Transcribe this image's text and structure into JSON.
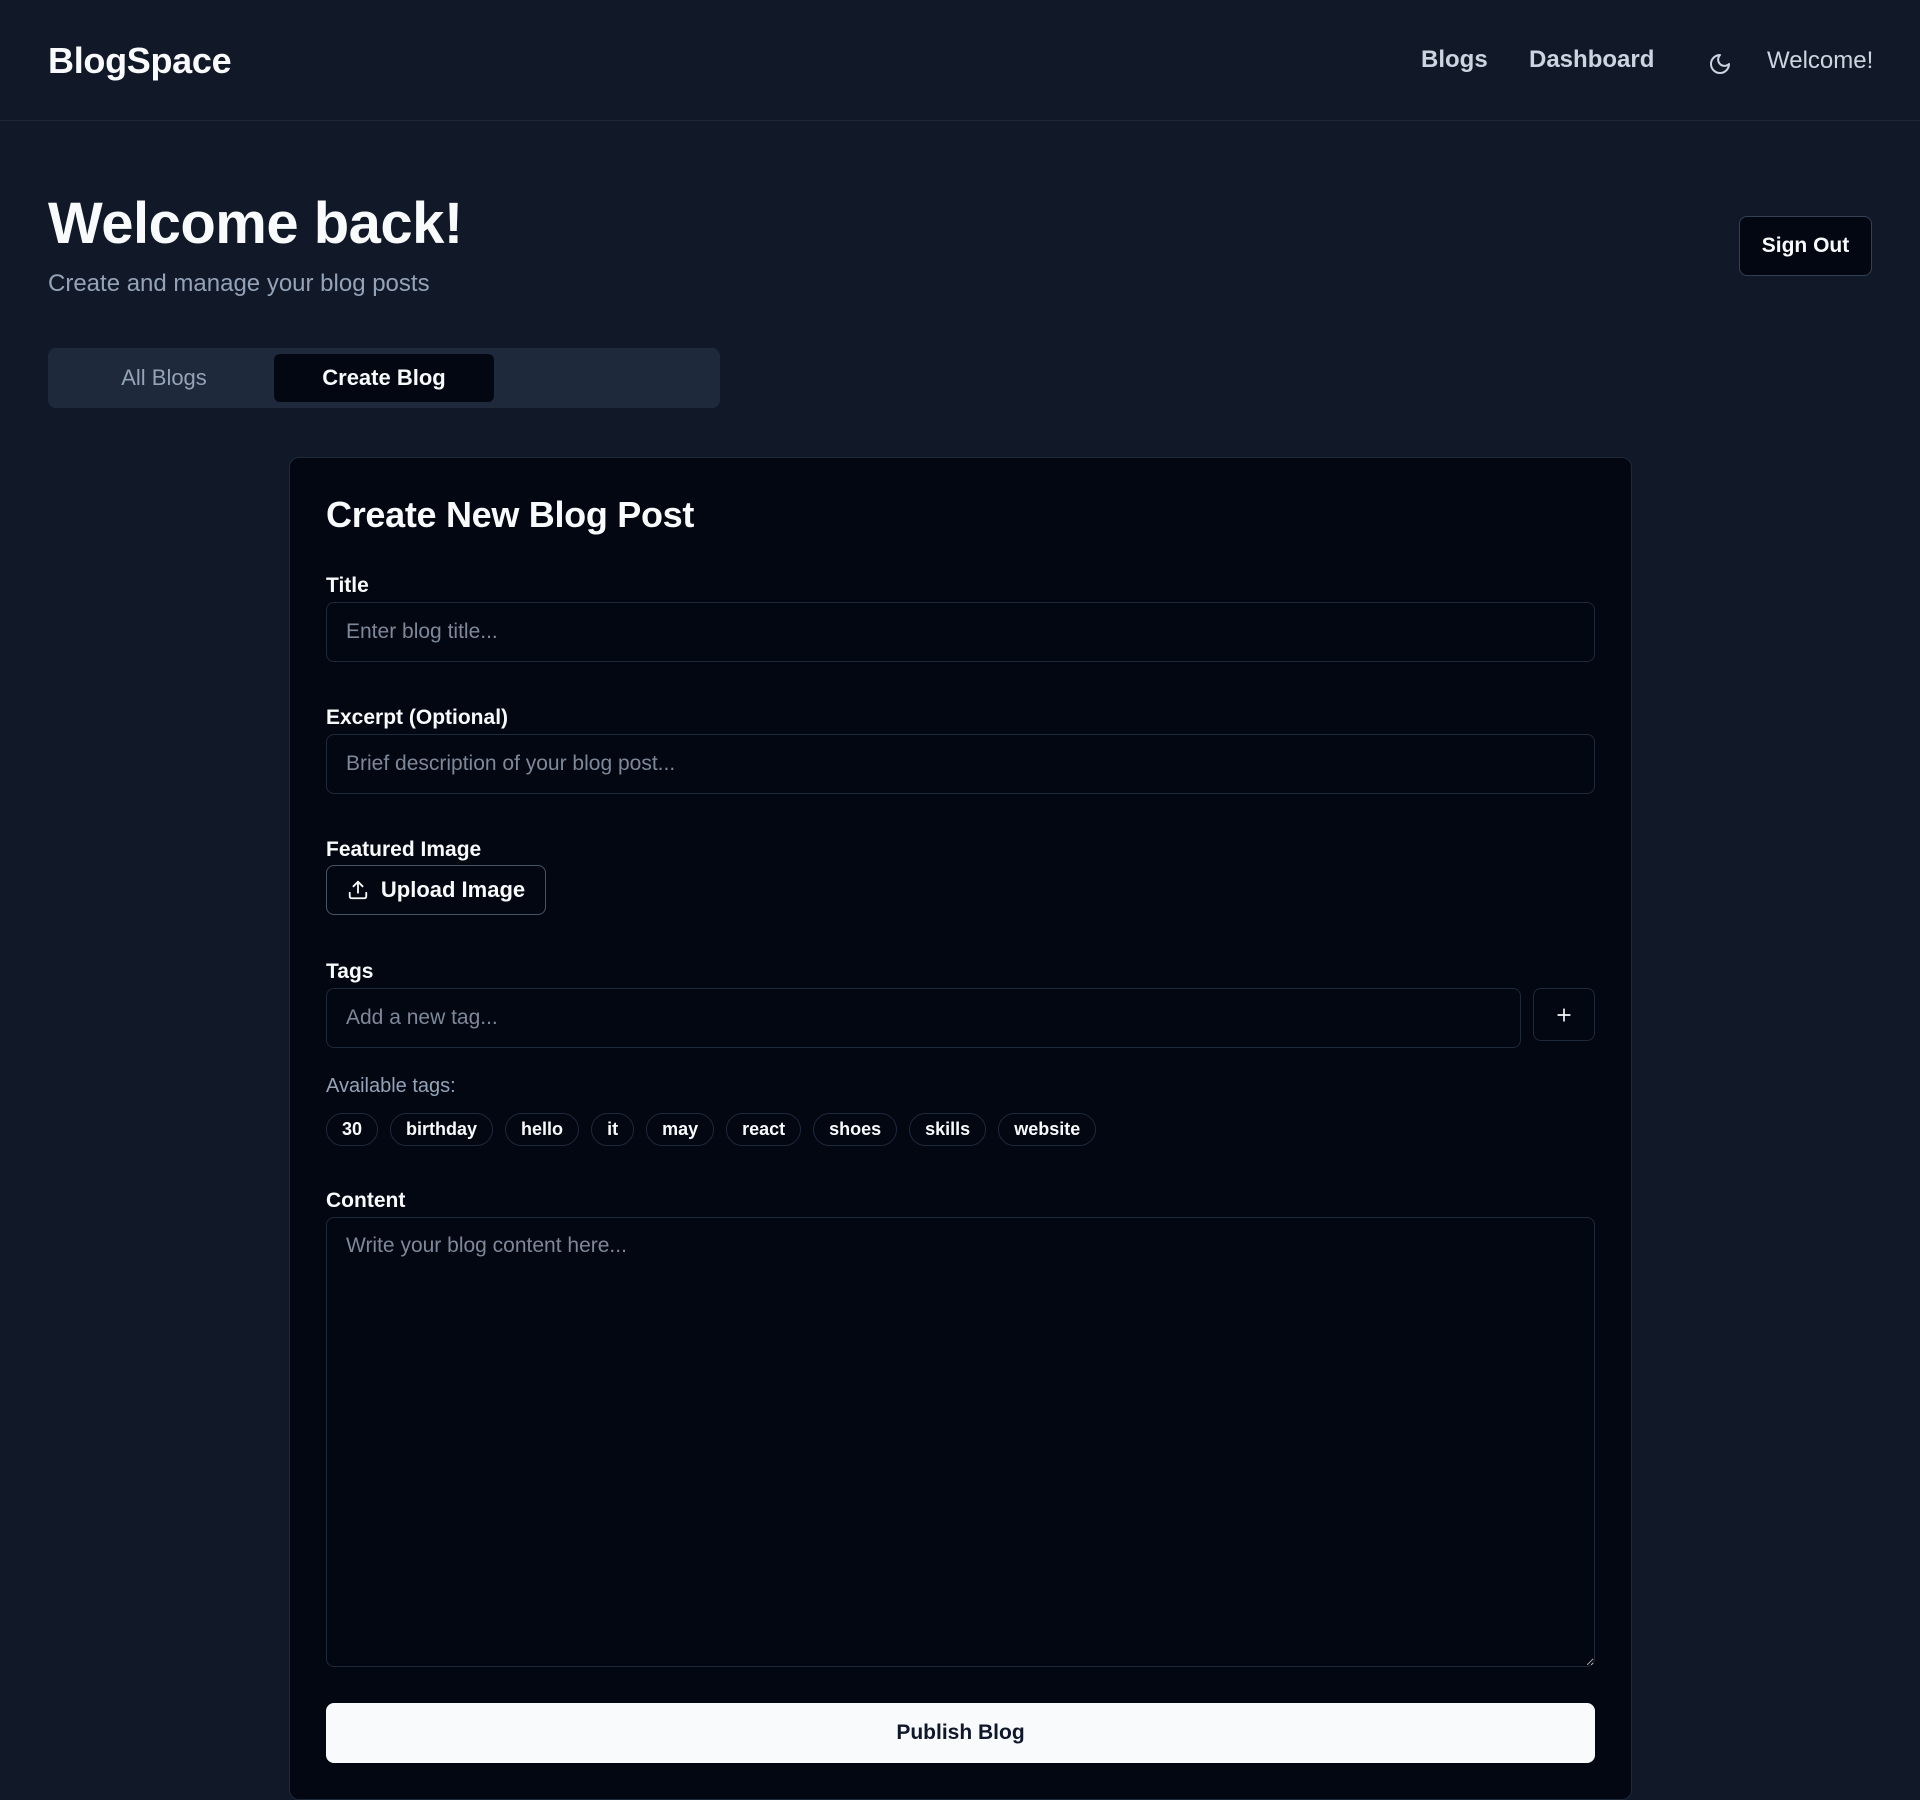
{
  "nav": {
    "brand": "BlogSpace",
    "links": [
      "Blogs",
      "Dashboard"
    ],
    "theme_icon": "moon-icon",
    "welcome": "Welcome!"
  },
  "header": {
    "title": "Welcome back!",
    "subtitle": "Create and manage your blog posts",
    "signout_label": "Sign Out"
  },
  "tabs": [
    {
      "label": "All Blogs",
      "active": false
    },
    {
      "label": "Create Blog",
      "active": true
    }
  ],
  "form": {
    "heading": "Create New Blog Post",
    "title_label": "Title",
    "title_placeholder": "Enter blog title...",
    "title_value": "",
    "excerpt_label": "Excerpt (Optional)",
    "excerpt_placeholder": "Brief description of your blog post...",
    "excerpt_value": "",
    "image_label": "Featured Image",
    "upload_label": "Upload Image",
    "upload_icon": "upload-icon",
    "tags_label": "Tags",
    "tag_placeholder": "Add a new tag...",
    "add_tag_icon": "plus-icon",
    "available_tags_label": "Available tags:",
    "available_tags": [
      "30",
      "birthday",
      "hello",
      "it",
      "may",
      "react",
      "shoes",
      "skills",
      "website"
    ],
    "content_label": "Content",
    "content_placeholder": "Write your blog content here...",
    "content_value": "",
    "publish_label": "Publish Blog"
  },
  "colors": {
    "page_bg": "#111827",
    "card_bg": "#030712",
    "border": "#1e293b",
    "text_primary": "#f8fafc",
    "text_muted": "#94a3b8",
    "button_primary_bg": "#f8fafc"
  }
}
